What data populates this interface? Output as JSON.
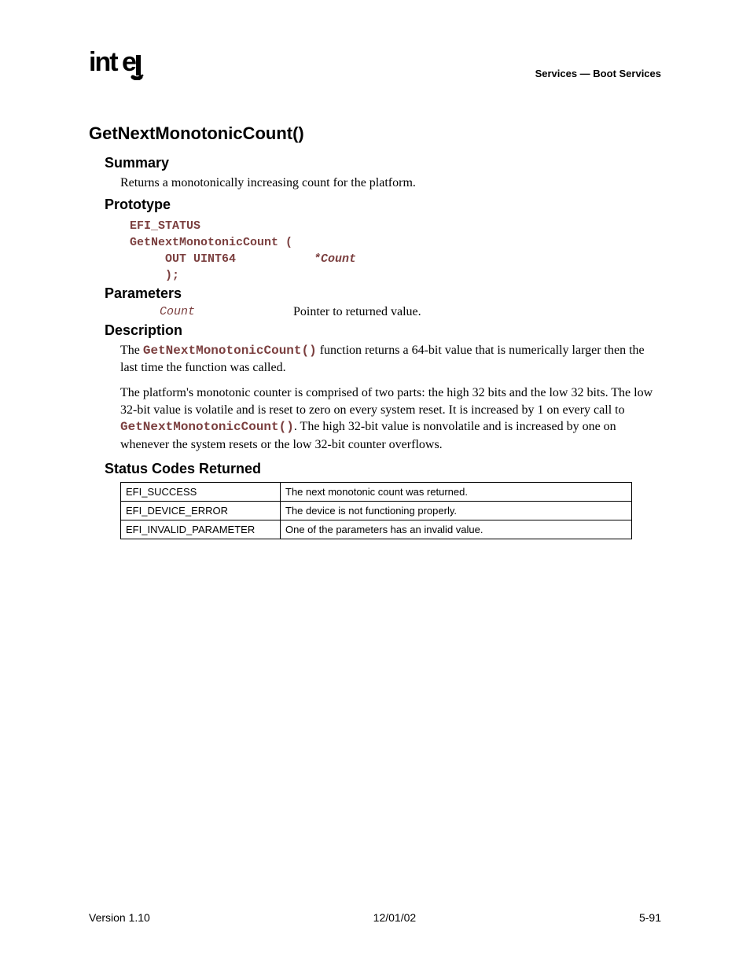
{
  "header": {
    "logo": "intel",
    "breadcrumb": "Services — Boot Services"
  },
  "title": "GetNextMonotonicCount()",
  "summary": {
    "heading": "Summary",
    "text": "Returns a monotonically increasing count for the platform."
  },
  "prototype": {
    "heading": "Prototype",
    "line1": "EFI_STATUS",
    "line2": "GetNextMonotonicCount (",
    "line3a": "     OUT UINT64           ",
    "line3b": "*Count",
    "line4": "     );"
  },
  "parameters": {
    "heading": "Parameters",
    "rows": [
      {
        "name": "Count",
        "desc": "Pointer to returned value."
      }
    ]
  },
  "description": {
    "heading": "Description",
    "p1a": "The ",
    "p1code": "GetNextMonotonicCount()",
    "p1b": " function returns a 64-bit value that is numerically larger then the last time the function was called.",
    "p2a": "The platform's monotonic counter is comprised of two parts:  the high 32 bits and the low 32 bits.  The low 32-bit value is volatile and is reset to zero on every system reset.  It  is increased by 1 on every call to ",
    "p2code": "GetNextMonotonicCount()",
    "p2b": ".  The high 32-bit value is nonvolatile and is increased by one on whenever the system resets or the low 32-bit counter overflows."
  },
  "status": {
    "heading": "Status Codes Returned",
    "rows": [
      {
        "code": "EFI_SUCCESS",
        "desc": "The next monotonic count was returned."
      },
      {
        "code": "EFI_DEVICE_ERROR",
        "desc": "The device is not functioning properly."
      },
      {
        "code": "EFI_INVALID_PARAMETER",
        "desc": "One of the parameters has an invalid value."
      }
    ]
  },
  "footer": {
    "left": "Version 1.10",
    "center": "12/01/02",
    "right": "5-91"
  }
}
